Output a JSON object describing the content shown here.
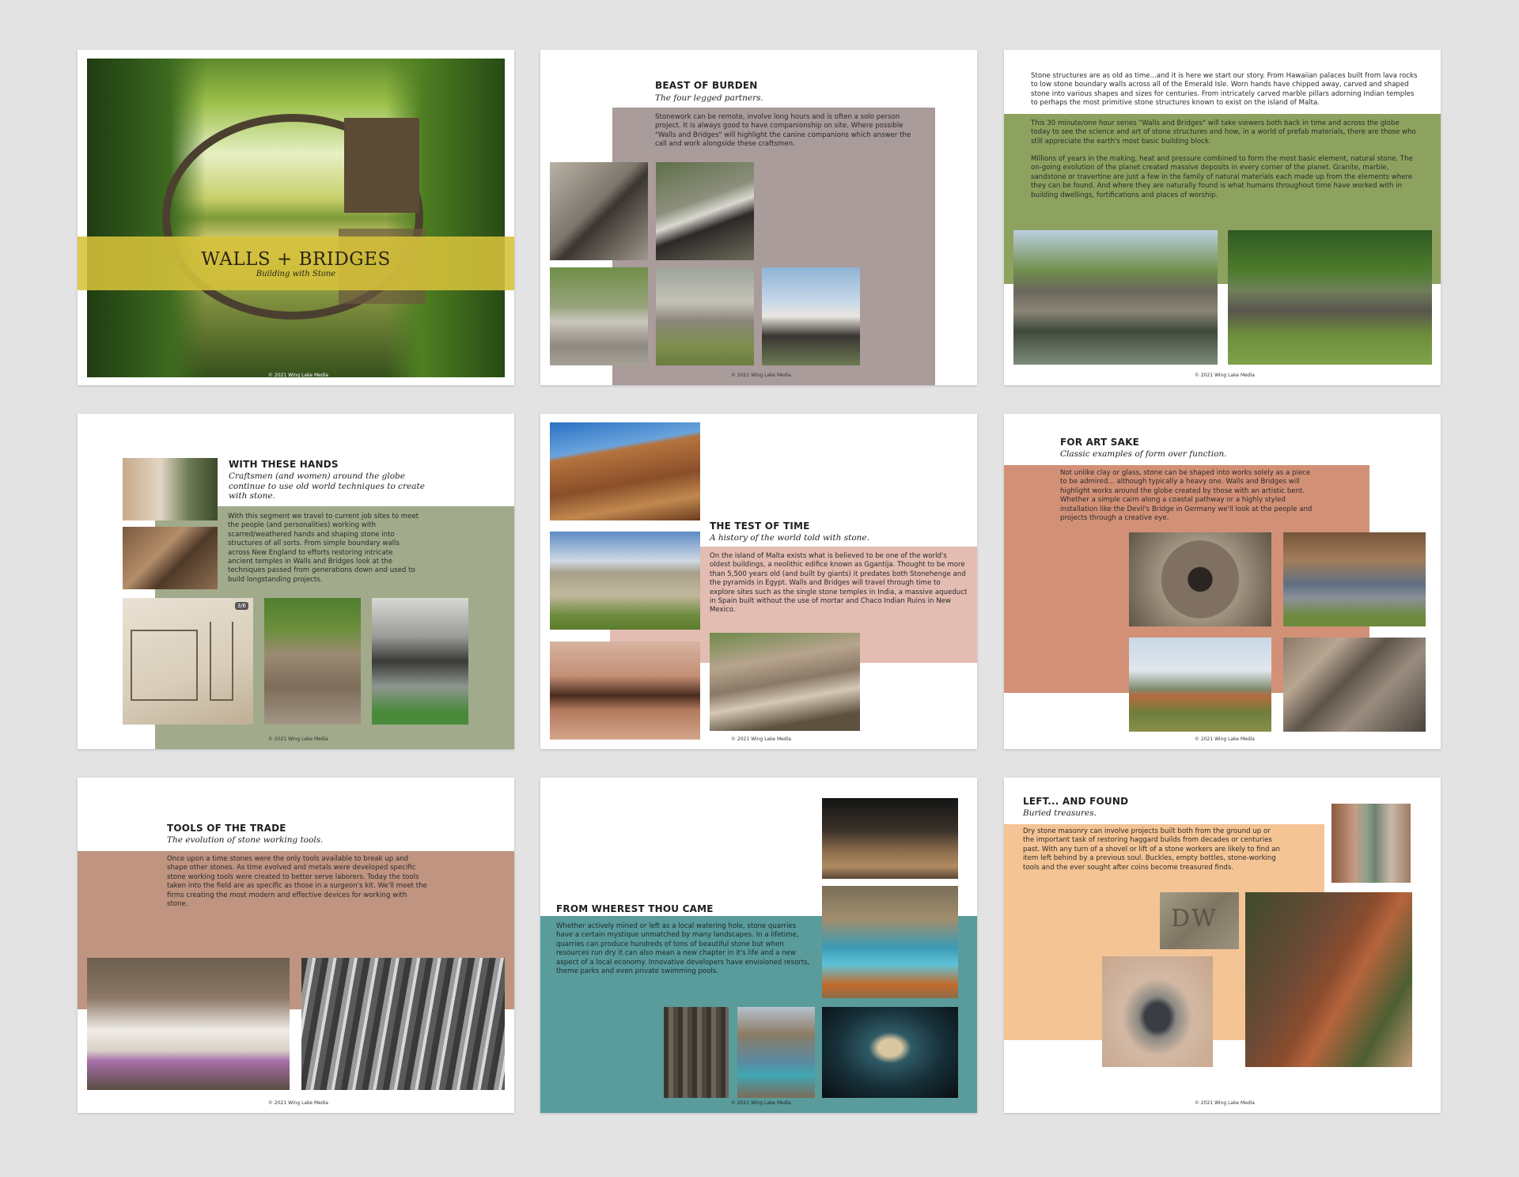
{
  "copyright": "© 2021 Wing Lake Media",
  "colors": {
    "background": "#e3e3e4",
    "cover_band": "#d6c13a",
    "mauve": "#a99c9a",
    "olive": "#8ea25f",
    "sage": "#a1aa8a",
    "salmon": "#e3bcb2",
    "terracotta": "#d29177",
    "clay": "#bf9480",
    "teal": "#5a9b9b",
    "peach": "#f4c495"
  },
  "slides": {
    "cover": {
      "title": "WALLS + BRIDGES",
      "subtitle": "Building with Stone",
      "copyright": "© 2021 Wing Lake Media"
    },
    "beast": {
      "title": "BEAST OF BURDEN",
      "subtitle": "The four legged partners.",
      "body": "Stonework can be remote, involve long hours and is often a solo person project. It is always good to have companionship on site. Where possible \"Walls and Bridges\" will highlight the canine companions which answer the call and work alongside these craftsmen.",
      "copyright": "© 2021 Wing Lake Media"
    },
    "intro": {
      "para1": "Stone structures are as old as time...and it is here we start our story. From Hawaiian palaces built from lava rocks to low stone boundary walls across all of the Emerald Isle. Worn hands have chipped away, carved and shaped stone into various shapes and sizes for centuries. From intricately carved marble pillars adorning Indian temples to perhaps the most primitive stone structures known to exist on the island of Malta.",
      "para2": "This 30 minute/one hour series \"Walls and Bridges\" will take viewers both back in time and across the globe today to see the science and art of stone structures and how, in a world of prefab materials, there are those who still appreciate the earth's most basic building block.",
      "para3": "Millions of years in the making, heat and pressure combined to form the most basic element, natural stone. The on-going evolution of the planet created massive deposits in every corner of the planet. Granite, marble, sandstone or travertine are just a few in the family of natural materials each made up from the elements where they can be found. And where they are naturally found is what humans throughout time have worked with in building dwellings, fortifications and places of worship.",
      "copyright": "© 2021 Wing Lake Media"
    },
    "hands": {
      "title": "WITH THESE HANDS",
      "subtitle": "Craftsmen (and women) around the globe continue to use old world techniques to create with stone.",
      "body": "With this segment we travel to current job sites to meet the people (and personalities) working with scarred/weathered hands and shaping stone into structures of all sorts. From simple boundary walls across New England to efforts restoring intricate ancient temples in Walls and Bridges look at the techniques passed from generations down and used to build longstanding projects.",
      "sketch_badge": "3/6",
      "copyright": "© 2021 Wing Lake Media"
    },
    "time": {
      "title": "THE TEST OF TIME",
      "subtitle": "A history of the world told with stone.",
      "body": "On the island of Malta exists what is believed to be one of the world's oldest buildings, a neolithic edifice known as Ggantija. Thought to be more than 5,500 years old (and built by giants) it predates both Stonehenge and the pyramids in Egypt.  Walls and Bridges will travel through time to explore sites such as the single stone temples in India, a massive aqueduct in Spain built without the use of mortar and Chaco Indian Ruins in New Mexico.",
      "copyright": "© 2021 Wing Lake Media"
    },
    "art": {
      "title": "FOR ART SAKE",
      "subtitle": "Classic examples of form over function.",
      "body": "Not unlike clay or glass, stone can be shaped into works solely as a piece to be admired... although typically a heavy one. Walls and Bridges will highlight works around the globe created by those with an artistic bent. Whether a simple cairn along a coastal pathway or a highly styled installation like the Devil's Bridge in Germany we'll look at the people and projects through a creative eye.",
      "copyright": "© 2021 Wing Lake Media"
    },
    "tools": {
      "title": "TOOLS OF THE TRADE",
      "subtitle": "The evolution of stone working tools.",
      "body": "Once upon a time stones were the only tools available to break up and shape other stones. As time evolved and metals were developed specific stone working tools were created to better serve laborers. Today the tools taken into the field are as specific as those in a surgeon's kit. We'll meet the firms creating the most modern and effective devices for working with stone.",
      "copyright": "© 2021 Wing Lake Media"
    },
    "whence": {
      "title": "FROM WHEREST THOU CAME",
      "body": "Whether actively mined or left as a local watering hole, stone quarries have a  certain mystique unmatched by many landscapes. In a lifetime, quarries can produce hundreds of tons of beautiful stone but when resources run dry it can also mean a new chapter in it's life and a new aspect of a local economy. Innovative developers have envisioned resorts, theme parks and even private swimming pools.",
      "copyright": "© 2021 Wing Lake Media"
    },
    "found": {
      "title": "LEFT... AND FOUND",
      "subtitle": "Buried treasures.",
      "body": "Dry stone masonry can involve projects built both from the ground up or the important task of restoring haggard builds from decades or centuries past.  With any turn of a shovel or lift of a stone workers are likely to find an item left behind by a previous soul. Buckles, empty bottles, stone-working tools and the ever sought after coins become treasured finds.",
      "stamp_text": "DW",
      "copyright": "© 2021 Wing Lake Media"
    }
  }
}
